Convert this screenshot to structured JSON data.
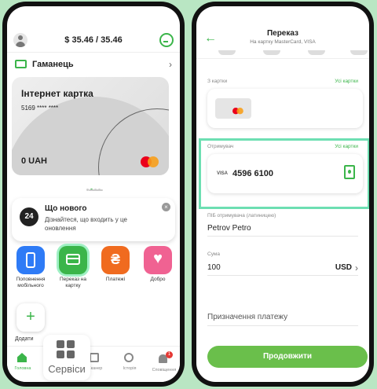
{
  "left": {
    "balance": "$ 35.46 / 35.46",
    "wallet_label": "Гаманець",
    "card": {
      "title": "Інтернет картка",
      "number": "5169 **** ****",
      "amount": "0 UAH"
    },
    "news": {
      "badge": "24",
      "title": "Що нового",
      "text": "Дізнайтеся, що входить у це оновлення"
    },
    "shortcuts": [
      {
        "label": "Поповнення мобільного",
        "color": "#2e7bf6",
        "icon": "phone-icon"
      },
      {
        "label": "Переказ на картку",
        "color": "#3bb54a",
        "icon": "card-icon"
      },
      {
        "label": "Платежі",
        "color": "#f06b1f",
        "icon": "hryvnia-icon"
      },
      {
        "label": "Добро",
        "color": "#f06292",
        "icon": "heart-icon"
      }
    ],
    "add_label": "Додати",
    "services_label": "Сервіси",
    "nav": [
      {
        "label": "Головна"
      },
      {
        "label": "Сканер"
      },
      {
        "label": "Історія"
      },
      {
        "label": "Сповіщення",
        "badge": "1"
      }
    ]
  },
  "right": {
    "title": "Переказ",
    "subtitle": "На картку MasterCard, VISA",
    "from_label": "З картки",
    "from_link": "Усі картки",
    "recipient_label": "Отримувач",
    "recipient_link": "Усі картки",
    "card_brand": "VISA",
    "recipient_number": "4596 6100",
    "name_label": "ПІБ отримувача (латиницею)",
    "name_value": "Petrov Petro",
    "amount_label": "Сума",
    "amount_value": "100",
    "currency": "USD",
    "purpose_placeholder": "Призначення платежу",
    "continue_label": "Продовжити"
  },
  "colors": {
    "accent": "#3bb54a",
    "highlight": "#6ddfb2",
    "background": "#b9e6c3"
  }
}
